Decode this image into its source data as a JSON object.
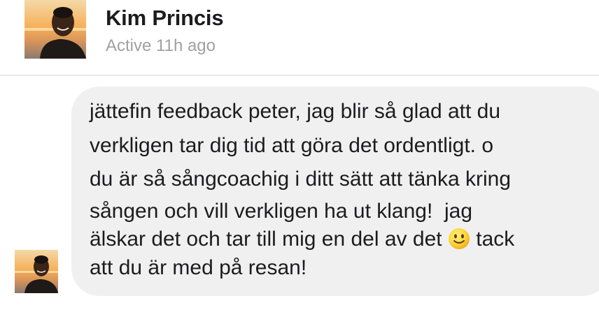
{
  "header": {
    "name": "Kim Princis",
    "status": "Active 11h ago",
    "avatar_icon": "profile-photo-icon"
  },
  "message": {
    "lines": [
      "jättefin feedback peter, jag blir så glad att du",
      "verkligen tar dig tid att göra det ordentligt. o",
      "du är så sångcoachig i ditt sätt att tänka kring",
      "sången och vill verkligen ha ut klang!  jag",
      "älskar det och tar till mig en del av det ",
      " tack",
      "att du är med på resan!"
    ],
    "emoji": "slightly-smiling-face-icon",
    "bubble_color": "#f1f0f0",
    "sender_avatar_icon": "profile-photo-icon"
  },
  "colors": {
    "name": "#1c1c1e",
    "status": "#a0a0a5",
    "divider": "#e9e9eb"
  }
}
